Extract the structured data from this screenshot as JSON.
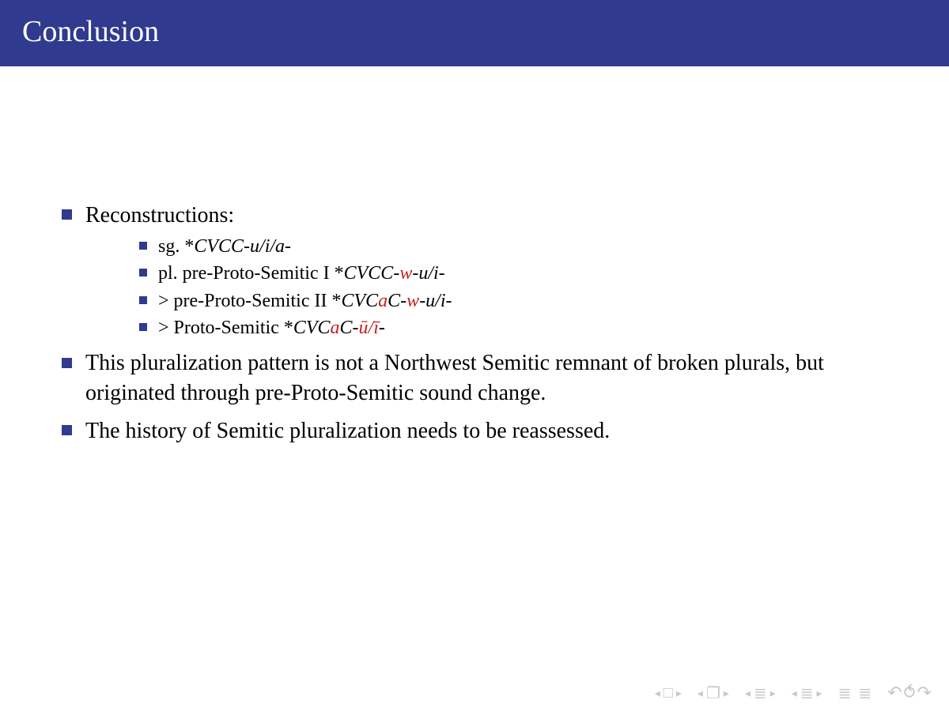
{
  "title": "Conclusion",
  "bullets": {
    "reconstructions_label": "Reconstructions:",
    "sg": {
      "prefix": "sg. *",
      "pattern": "CVCC-u/i/a",
      "suffix": "-"
    },
    "pl1": {
      "prefix": "pl. pre-Proto-Semitic I *",
      "pattern_a": "CVCC-",
      "red": "w",
      "pattern_b": "-u/i",
      "suffix": "-"
    },
    "pl2": {
      "prefix": "> pre-Proto-Semitic II *",
      "pattern_a": "CVC",
      "red_a": "a",
      "pattern_b": "C-",
      "red_b": "w",
      "pattern_c": "-u/i",
      "suffix": "-"
    },
    "pl3": {
      "prefix": "> Proto-Semitic *",
      "pattern_a": "CVC",
      "red_a": "a",
      "pattern_b": "C-",
      "red_b": "ū/ī",
      "suffix": "-"
    },
    "point2": "This pluralization pattern is not a Northwest Semitic remnant of broken plurals, but originated through pre-Proto-Semitic sound change.",
    "point3": "The history of Semitic pluralization needs to be reassessed."
  }
}
